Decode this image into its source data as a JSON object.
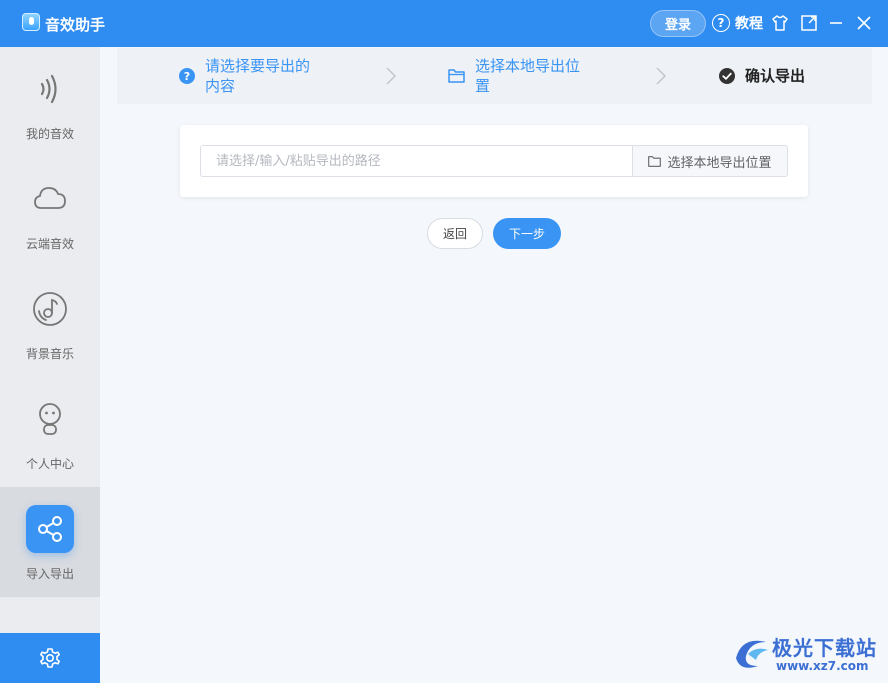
{
  "app": {
    "title": "音效助手"
  },
  "header": {
    "login_label": "登录",
    "tutorial_label": "教程"
  },
  "sidebar": {
    "items": [
      {
        "label": "我的音效",
        "icon": "sound-wave-icon"
      },
      {
        "label": "云端音效",
        "icon": "cloud-icon"
      },
      {
        "label": "背景音乐",
        "icon": "music-disc-icon"
      },
      {
        "label": "个人中心",
        "icon": "user-robot-icon"
      },
      {
        "label": "导入导出",
        "icon": "share-icon",
        "active": true
      }
    ],
    "settings_icon": "gear-icon"
  },
  "steps": [
    {
      "line1": "请选择要导出的",
      "line2": "内容",
      "icon": "question-circle-icon",
      "state": "pending"
    },
    {
      "line1": "选择本地导出位",
      "line2": "置",
      "icon": "folder-icon",
      "state": "pending"
    },
    {
      "line1": "确认导出",
      "line2": "",
      "icon": "check-circle-icon",
      "state": "current"
    }
  ],
  "export": {
    "path_value": "",
    "path_placeholder": "请选择/输入/粘贴导出的路径",
    "choose_label": "选择本地导出位置"
  },
  "actions": {
    "back_label": "返回",
    "next_label": "下一步"
  },
  "watermark": {
    "title": "极光下载站",
    "url": "www.xz7.com"
  },
  "colors": {
    "accent": "#2f8cf0",
    "sidebar_bg": "#eaecef",
    "content_bg": "#f4f7fc"
  }
}
